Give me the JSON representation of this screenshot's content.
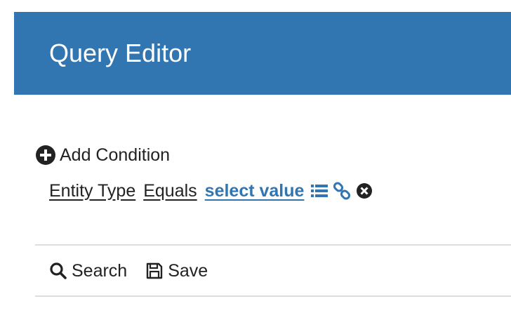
{
  "header": {
    "title": "Query Editor"
  },
  "add_condition": {
    "label": "Add Condition"
  },
  "condition": {
    "field": "Entity Type",
    "operator": "Equals",
    "value": "select value",
    "icons": [
      "list-icon",
      "link-icon",
      "remove-icon"
    ]
  },
  "toolbar": {
    "search_label": "Search",
    "save_label": "Save"
  },
  "colors": {
    "header_bg": "#3276b1",
    "accent": "#3276b1",
    "divider": "#dddddd"
  }
}
